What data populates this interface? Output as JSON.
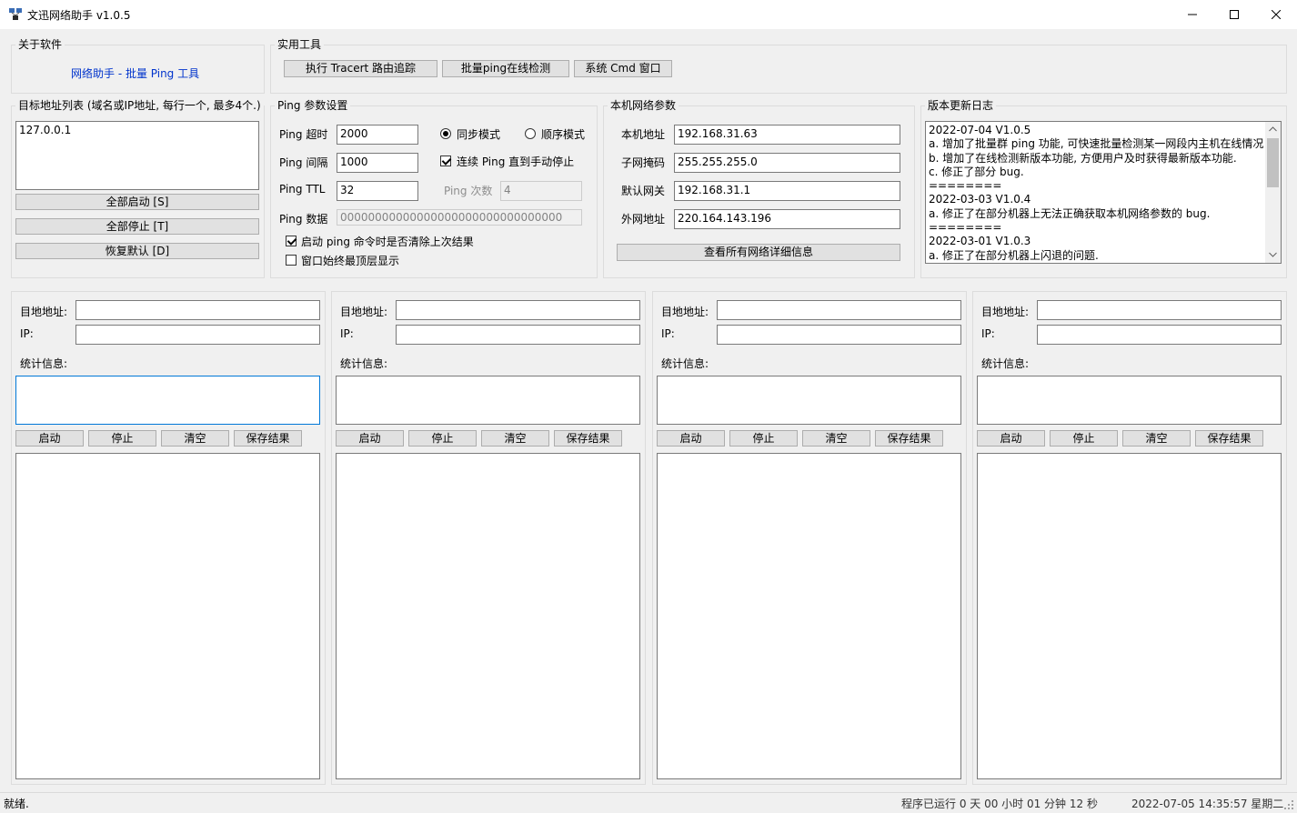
{
  "window": {
    "title": "文迅网络助手  v1.0.5"
  },
  "about": {
    "group_label": "关于软件",
    "link_text": "网络助手 - 批量 Ping 工具",
    "link_color": "#0033cc"
  },
  "tools": {
    "group_label": "实用工具",
    "tracert_button": "执行 Tracert 路由追踪",
    "batch_ping_button": "批量ping在线检测",
    "cmd_button": "系统 Cmd 窗口"
  },
  "targets": {
    "group_label": "目标地址列表 (域名或IP地址, 每行一个, 最多4个.)",
    "list_value": "127.0.0.1",
    "start_all_button": "全部启动 [S]",
    "stop_all_button": "全部停止 [T]",
    "reset_button": "恢复默认 [D]"
  },
  "ping_settings": {
    "group_label": "Ping 参数设置",
    "timeout_label": "Ping 超时",
    "timeout_value": "2000",
    "interval_label": "Ping 间隔",
    "interval_value": "1000",
    "ttl_label": "Ping TTL",
    "ttl_value": "32",
    "count_label": "Ping 次数",
    "count_value": "4",
    "data_label": "Ping 数据",
    "data_value": "00000000000000000000000000000000",
    "sync_mode_label": "同步模式",
    "sync_mode_checked": true,
    "seq_mode_label": "顺序模式",
    "seq_mode_checked": false,
    "continuous_label": "连续 Ping 直到手动停止",
    "continuous_checked": true,
    "clear_on_start_label": "启动 ping 命令时是否清除上次结果",
    "clear_on_start_checked": true,
    "topmost_label": "窗口始终最顶层显示",
    "topmost_checked": false
  },
  "network": {
    "group_label": "本机网络参数",
    "local_label": "本机地址",
    "local_value": "192.168.31.63",
    "mask_label": "子网掩码",
    "mask_value": "255.255.255.0",
    "gateway_label": "默认网关",
    "gateway_value": "192.168.31.1",
    "public_label": "外网地址",
    "public_value": "220.164.143.196",
    "details_button": "查看所有网络详细信息"
  },
  "changelog": {
    "group_label": "版本更新日志",
    "lines": [
      "2022-07-04  V1.0.5",
      "a. 增加了批量群 ping 功能, 可快速批量检测某一网段内主机在线情况.",
      "b. 增加了在线检测新版本功能, 方便用户及时获得最新版本功能.",
      "c. 修正了部分 bug.",
      "========",
      "2022-03-03  V1.0.4",
      "a. 修正了在部分机器上无法正确获取本机网络参数的 bug.",
      "========",
      "2022-03-01  V1.0.3",
      "a. 修正了在部分机器上闪退的问题."
    ]
  },
  "panels": [
    {
      "dest_label": "目地地址:",
      "dest_value": "",
      "ip_label": "IP:",
      "ip_value": "",
      "stats_label": "统计信息:",
      "start": "启动",
      "stop": "停止",
      "clear": "清空",
      "save": "保存结果"
    },
    {
      "dest_label": "目地地址:",
      "dest_value": "",
      "ip_label": "IP:",
      "ip_value": "",
      "stats_label": "统计信息:",
      "start": "启动",
      "stop": "停止",
      "clear": "清空",
      "save": "保存结果"
    },
    {
      "dest_label": "目地地址:",
      "dest_value": "",
      "ip_label": "IP:",
      "ip_value": "",
      "stats_label": "统计信息:",
      "start": "启动",
      "stop": "停止",
      "clear": "清空",
      "save": "保存结果"
    },
    {
      "dest_label": "目地地址:",
      "dest_value": "",
      "ip_label": "IP:",
      "ip_value": "",
      "stats_label": "统计信息:",
      "start": "启动",
      "stop": "停止",
      "clear": "清空",
      "save": "保存结果"
    }
  ],
  "status": {
    "ready_text": "就绪.",
    "uptime_text": "程序已运行 0 天 00 小时 01 分钟 12 秒",
    "datetime_text": "2022-07-05 14:35:57 星期二"
  }
}
